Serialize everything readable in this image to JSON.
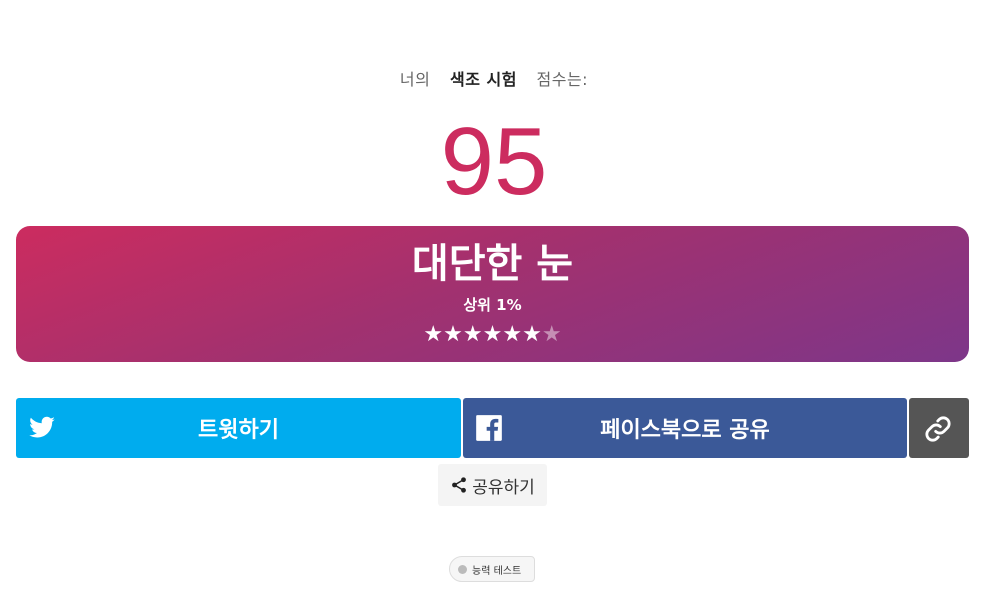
{
  "caption": {
    "prefix": "너의",
    "test_name": "색조 시험",
    "suffix": "점수는:"
  },
  "score": "95",
  "result": {
    "title": "대단한 눈",
    "rank": "상위 1%",
    "stars_filled": 6,
    "stars_total": 7,
    "stars": [
      "★",
      "★",
      "★",
      "★",
      "★",
      "★",
      "★"
    ]
  },
  "share": {
    "twitter_label": "트윗하기",
    "facebook_label": "페이스북으로 공유",
    "more_label": "공유하기"
  },
  "tag": {
    "label": "능력 테스트"
  },
  "colors": {
    "score": "#cc2c5f",
    "gradient_start": "#cc2c5f",
    "gradient_end": "#7d3689",
    "twitter": "#00acee",
    "facebook": "#3b5998",
    "link": "#555555"
  },
  "icons": {
    "twitter": "twitter-bird-icon",
    "facebook": "facebook-f-icon",
    "link": "link-chain-icon",
    "share": "share-nodes-icon"
  }
}
